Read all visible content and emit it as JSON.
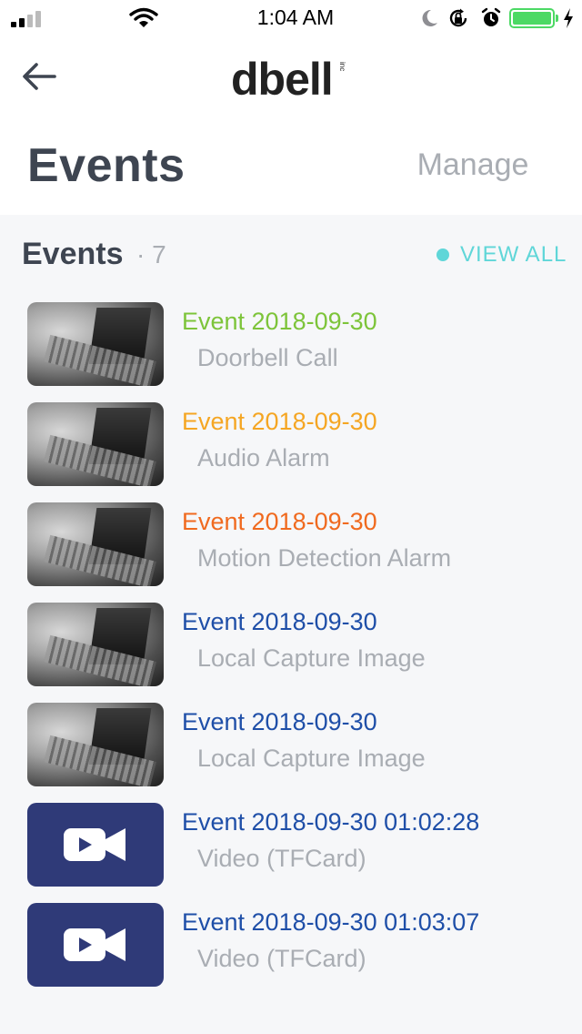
{
  "status_bar": {
    "time": "1:04 AM",
    "signal_icon": "cellular-signal-icon",
    "wifi_icon": "wifi-icon",
    "dnd_icon": "moon-icon",
    "rotation_lock_icon": "rotation-lock-icon",
    "alarm_icon": "alarm-clock-icon",
    "battery_icon": "battery-icon",
    "charging_icon": "charging-bolt-icon",
    "battery_color": "#4cd964"
  },
  "header": {
    "back_icon": "back-arrow-icon",
    "logo_text": "dbell",
    "logo_suffix": "inc",
    "title": "Events",
    "manage_label": "Manage"
  },
  "section": {
    "title": "Events",
    "count": "· 7",
    "view_all_label": "VIEW ALL",
    "accent_color": "#5fd6d8"
  },
  "events": [
    {
      "title": "Event 2018-09-30",
      "subtitle": "Doorbell Call",
      "color": "#7dc43a",
      "thumb": "photo"
    },
    {
      "title": "Event 2018-09-30",
      "subtitle": "Audio Alarm",
      "color": "#f5a623",
      "thumb": "photo"
    },
    {
      "title": "Event 2018-09-30",
      "subtitle": "Motion Detection Alarm",
      "color": "#f06a1f",
      "thumb": "photo"
    },
    {
      "title": "Event 2018-09-30",
      "subtitle": "Local Capture Image",
      "color": "#1f4fa8",
      "thumb": "photo"
    },
    {
      "title": "Event 2018-09-30",
      "subtitle": "Local Capture Image",
      "color": "#1f4fa8",
      "thumb": "photo"
    },
    {
      "title": "Event 2018-09-30 01:02:28",
      "subtitle": "Video (TFCard)",
      "color": "#1f4fa8",
      "thumb": "video"
    },
    {
      "title": "Event 2018-09-30 01:03:07",
      "subtitle": "Video (TFCard)",
      "color": "#1f4fa8",
      "thumb": "video"
    }
  ],
  "video_icon": "video-camera-icon"
}
